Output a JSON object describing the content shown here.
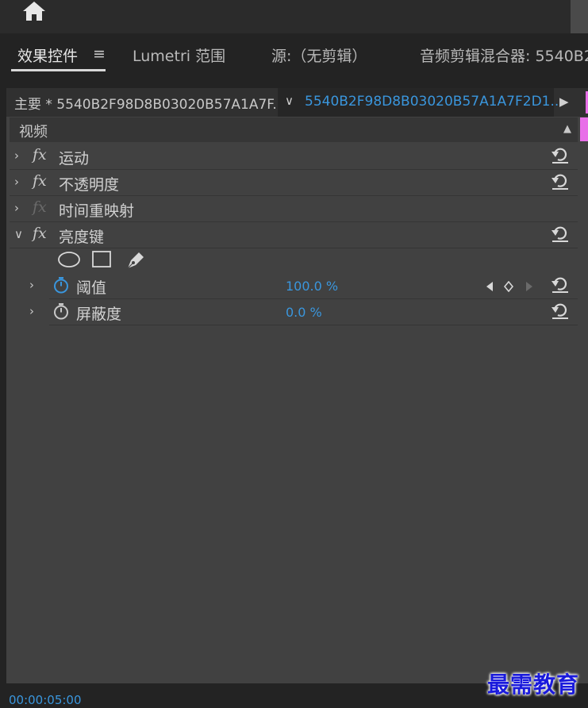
{
  "tabs": [
    {
      "label": "效果控件"
    },
    {
      "label": "Lumetri 范围"
    },
    {
      "label": "源:（无剪辑）"
    },
    {
      "label": "音频剪辑混合器: 5540B2"
    }
  ],
  "tab_menu_glyph": "≡",
  "clip_bar": {
    "master_label": "主要 * 5540B2F98D8B03020B57A1A7F...",
    "dropdown_glyph": "∨",
    "selected_clip": "5540B2F98D8B03020B57A1A7F2D1...",
    "play_glyph": "▶"
  },
  "section": {
    "label": "视频",
    "collapse_glyph": "▲"
  },
  "effects": [
    {
      "name": "运动",
      "fx": "fx",
      "twisty": "›"
    },
    {
      "name": "不透明度",
      "fx": "fx",
      "twisty": "›"
    },
    {
      "name": "时间重映射",
      "fx": "fx",
      "twisty": "›"
    },
    {
      "name": "亮度键",
      "fx": "fx",
      "twisty": "∨"
    }
  ],
  "params": [
    {
      "name": "阈值",
      "value": "100.0 %",
      "twisty": "›"
    },
    {
      "name": "屏蔽度",
      "value": "0.0 %",
      "twisty": "›"
    }
  ],
  "timecode": "00:00:05:00",
  "watermark": "最需教育",
  "colors": {
    "accent_blue": "#3a96dd",
    "marker_pink": "#e86fe8",
    "panel_bg": "#414141"
  },
  "icons": [
    "home-icon",
    "ellipse-mask-icon",
    "rectangle-mask-icon",
    "pen-mask-icon",
    "stopwatch-icon",
    "reset-icon",
    "prev-keyframe-icon",
    "add-keyframe-icon",
    "next-keyframe-icon"
  ]
}
